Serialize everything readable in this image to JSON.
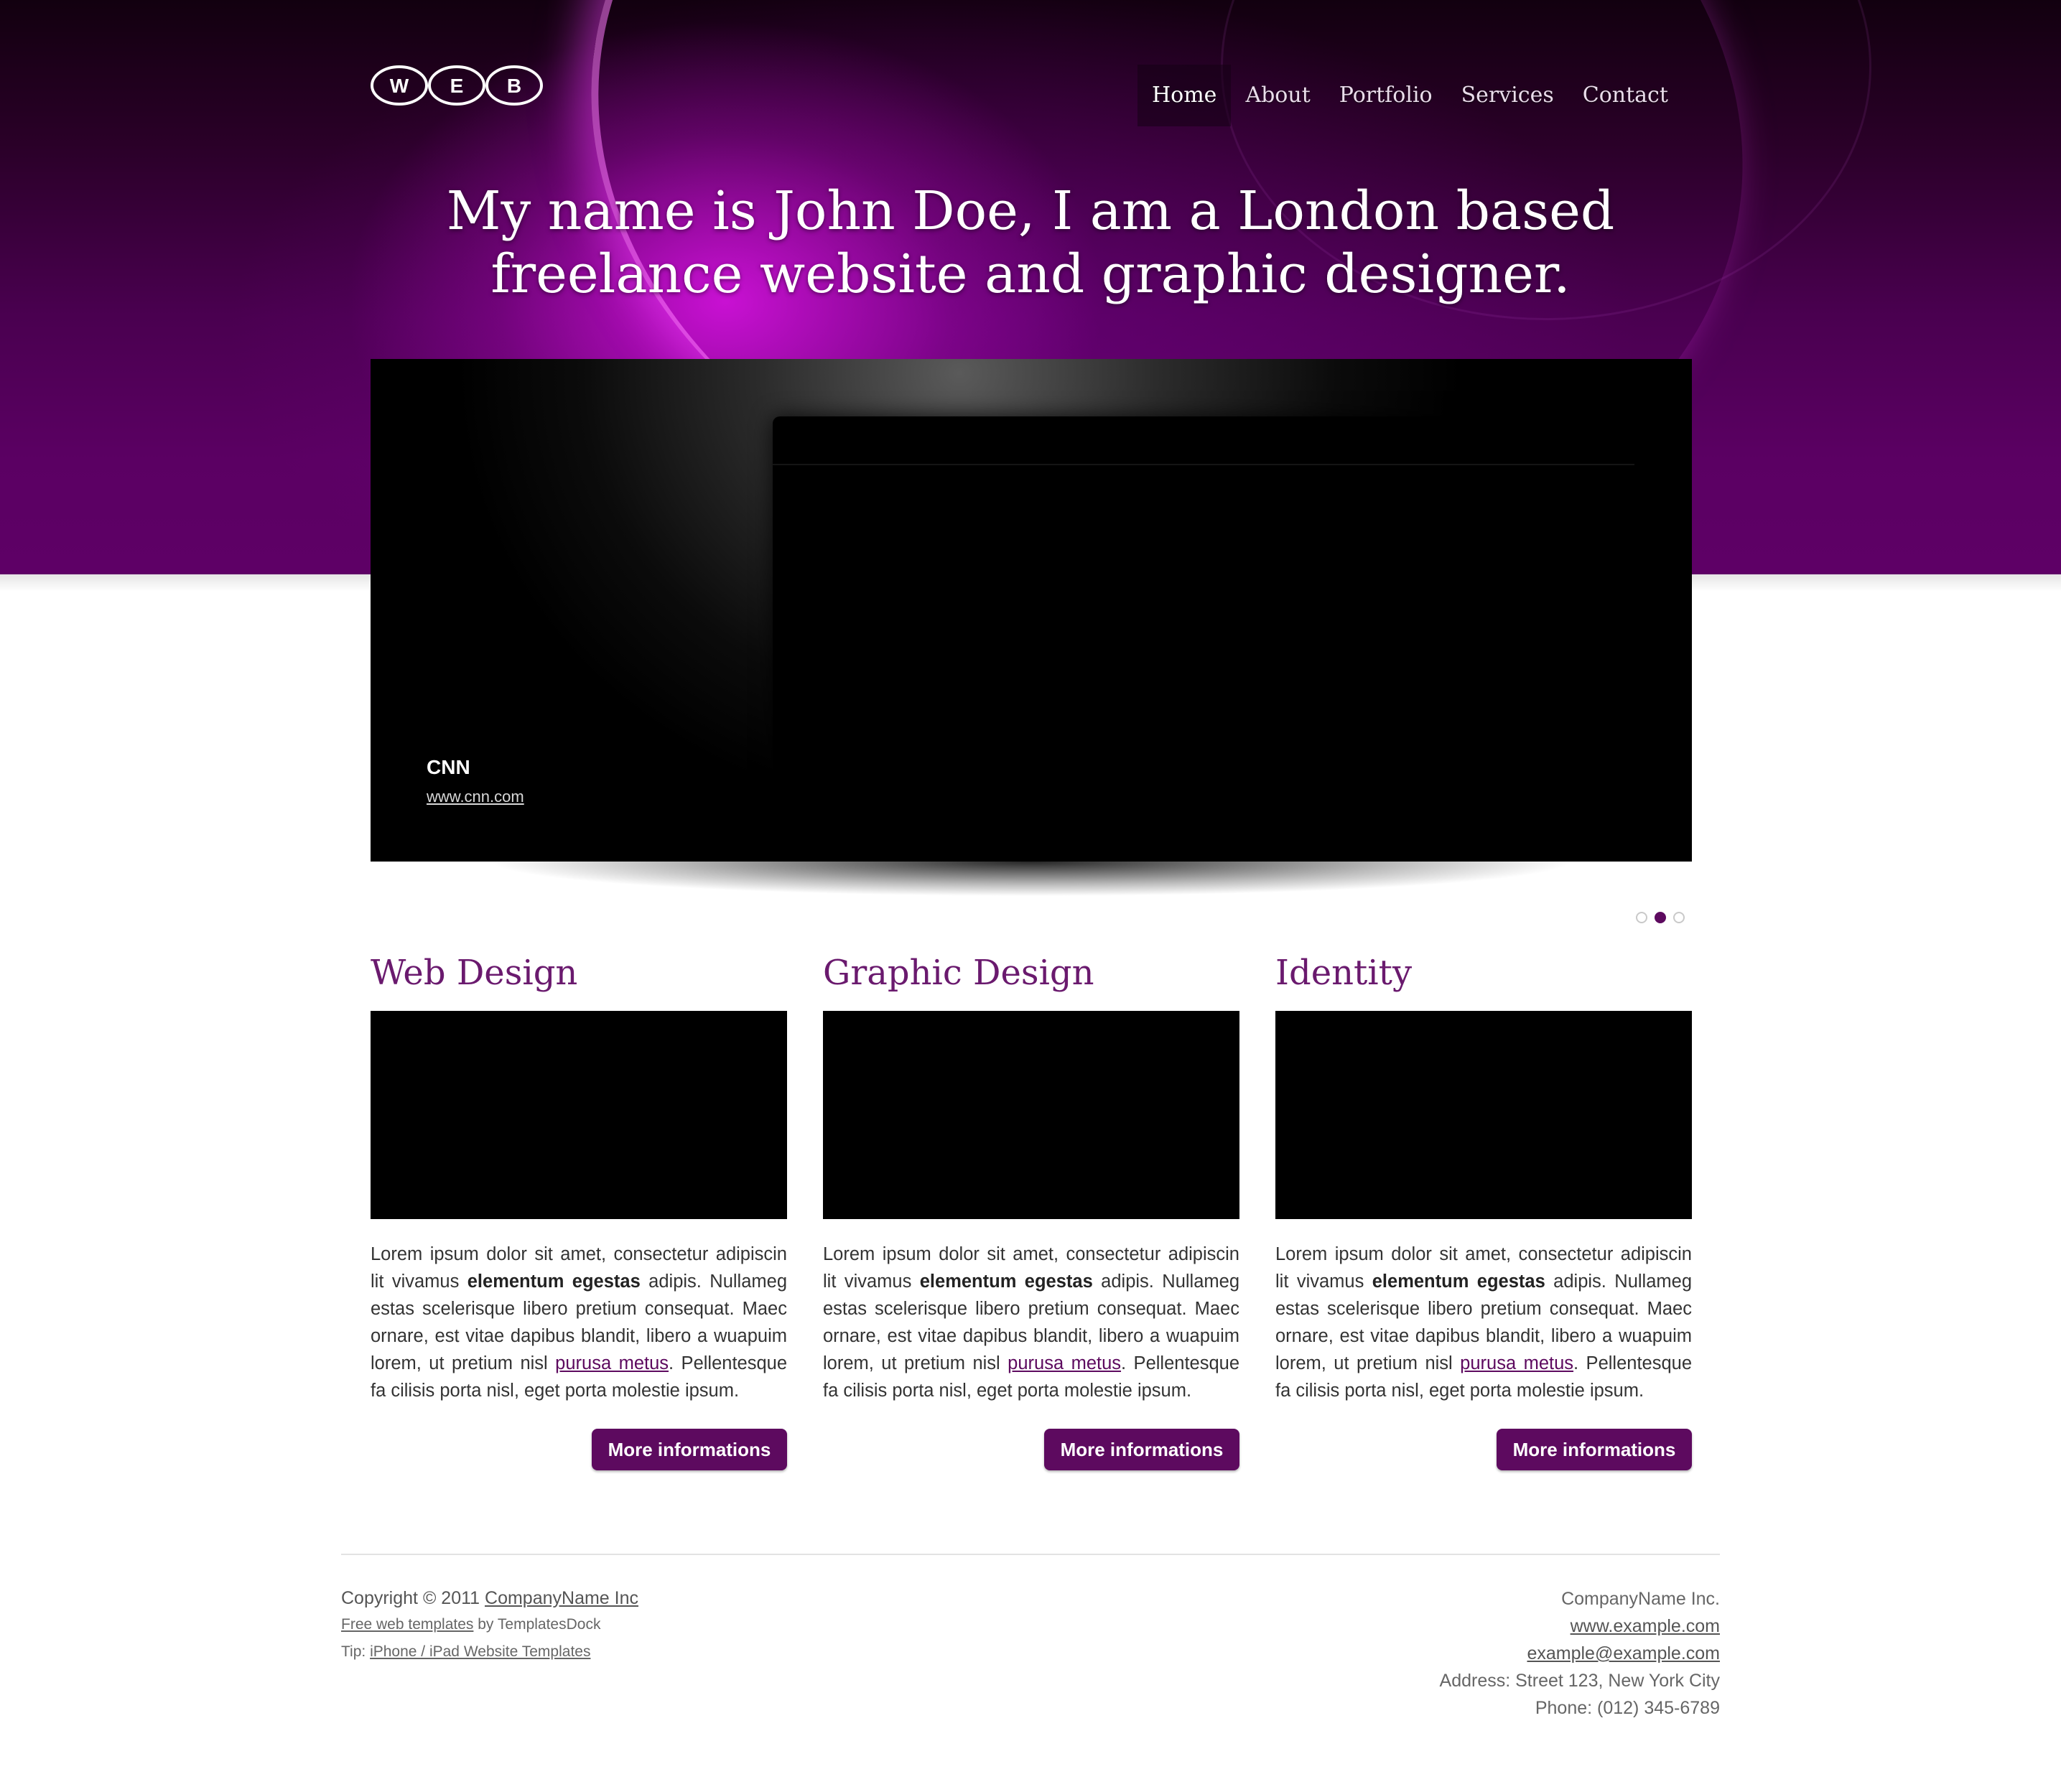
{
  "logo": {
    "letters": [
      "W",
      "E",
      "B"
    ]
  },
  "nav": {
    "items": [
      {
        "label": "Home",
        "active": true
      },
      {
        "label": "About"
      },
      {
        "label": "Portfolio"
      },
      {
        "label": "Services"
      },
      {
        "label": "Contact"
      }
    ]
  },
  "hero": {
    "headline_line1": "My name is John Doe, I am a London based",
    "headline_line2": "freelance website and graphic designer."
  },
  "slider": {
    "title": "CNN",
    "link": "www.cnn.com",
    "dots": 3,
    "active_dot": 2
  },
  "columns": [
    {
      "heading": "Web Design",
      "text_a": "Lorem ipsum dolor sit amet, consectetur adipiscin lit vivamus ",
      "bold": "elementum egestas",
      "text_b": " adipis. Nullameg estas scelerisque libero pretium consequat. Maec ornare, est vitae dapibus blandit, libero a wuapuim lorem, ut pretium nisl ",
      "link": "purusa metus",
      "text_c": ". Pellentesque fa cilisis porta nisl, eget porta molestie ipsum.",
      "button": "More informations"
    },
    {
      "heading": "Graphic Design",
      "text_a": "Lorem ipsum dolor sit amet, consectetur adipiscin lit vivamus ",
      "bold": "elementum egestas",
      "text_b": " adipis. Nullameg estas scelerisque libero pretium consequat. Maec ornare, est vitae dapibus blandit, libero a wuapuim lorem, ut pretium nisl ",
      "link": "purusa metus",
      "text_c": ". Pellentesque fa cilisis porta nisl, eget porta molestie ipsum.",
      "button": "More informations"
    },
    {
      "heading": "Identity",
      "text_a": "Lorem ipsum dolor sit amet, consectetur adipiscin lit vivamus ",
      "bold": "elementum egestas",
      "text_b": " adipis. Nullameg estas scelerisque libero pretium consequat. Maec ornare, est vitae dapibus blandit, libero a wuapuim lorem, ut pretium nisl ",
      "link": "purusa metus",
      "text_c": ". Pellentesque fa cilisis porta nisl, eget porta molestie ipsum.",
      "button": "More informations"
    }
  ],
  "footer": {
    "copyright_prefix": "Copyright © 2011 ",
    "company_link": "CompanyName Inc",
    "templates_link": "Free web templates",
    "templates_by": " by TemplatesDock",
    "tip_prefix": "Tip: ",
    "tip_link": "iPhone / iPad Website Templates",
    "right_company": "CompanyName Inc.",
    "right_website": "www.example.com",
    "right_email": "example@example.com",
    "right_address": "Address: Street 123, New York City",
    "right_phone": "Phone: (012) 345-6789"
  },
  "colors": {
    "accent": "#5d0a5f",
    "heading": "#6a1a6e"
  }
}
